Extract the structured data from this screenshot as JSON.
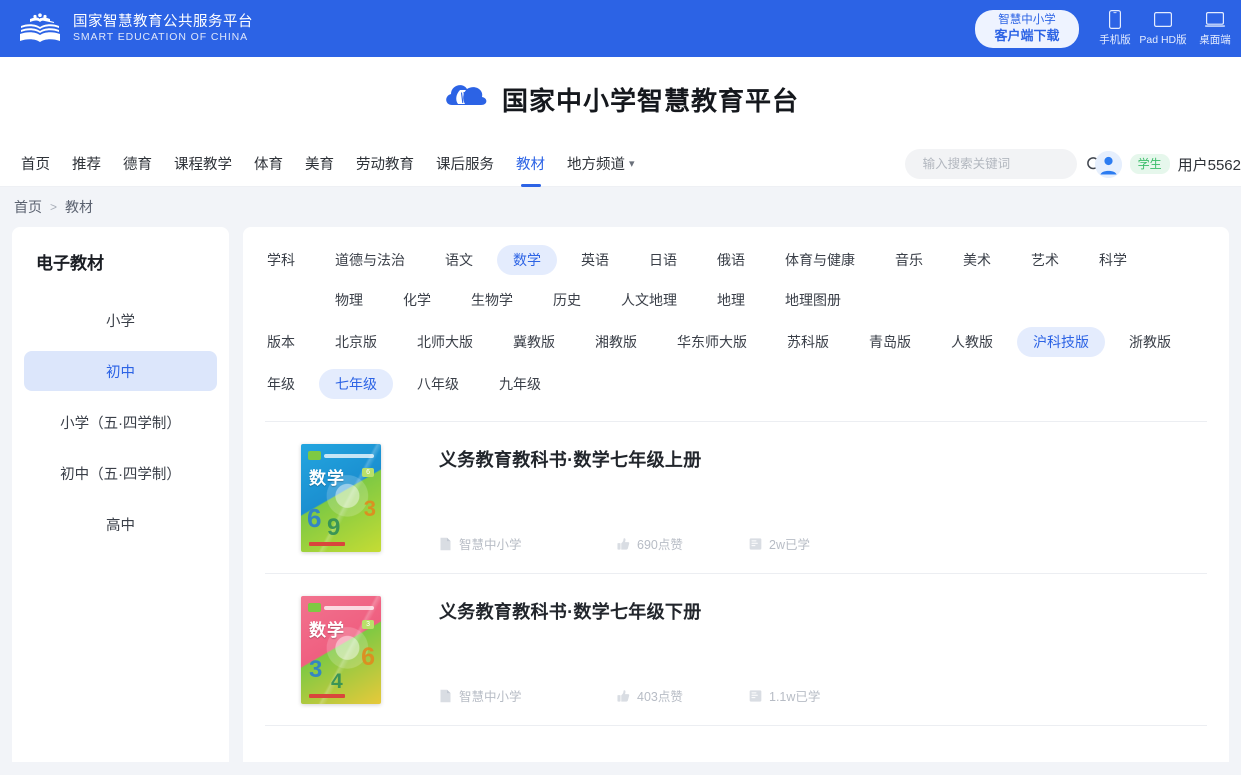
{
  "topbar": {
    "brand_cn": "国家智慧教育公共服务平台",
    "brand_en": "SMART EDUCATION OF CHINA",
    "logo_icon": "open-book-icon",
    "client_download": {
      "line1": "智慧中小学",
      "line2": "客户端下载"
    },
    "downloads": [
      {
        "label": "手机版",
        "icon": "phone-icon"
      },
      {
        "label": "Pad HD版",
        "icon": "tablet-icon"
      },
      {
        "label": "桌面端",
        "icon": "desktop-icon"
      }
    ],
    "bg_color": "#2c63e5"
  },
  "header": {
    "title": "国家中小学智慧教育平台",
    "logo_icon": "cloud-book-icon"
  },
  "nav": {
    "items": [
      {
        "label": "首页",
        "active": false
      },
      {
        "label": "推荐",
        "active": false
      },
      {
        "label": "德育",
        "active": false
      },
      {
        "label": "课程教学",
        "active": false
      },
      {
        "label": "体育",
        "active": false
      },
      {
        "label": "美育",
        "active": false
      },
      {
        "label": "劳动教育",
        "active": false
      },
      {
        "label": "课后服务",
        "active": false
      },
      {
        "label": "教材",
        "active": true
      },
      {
        "label": "地方频道",
        "active": false,
        "caret": true
      }
    ],
    "accent_color": "#2c63e5"
  },
  "search": {
    "placeholder": "输入搜索关键词",
    "value": "",
    "icon": "search-icon"
  },
  "user": {
    "avatar_icon": "user-avatar-icon",
    "role": "学生",
    "name": "用户5562",
    "role_color": "#3bbd6a"
  },
  "breadcrumb": {
    "items": [
      "首页",
      "教材"
    ],
    "separator": ">"
  },
  "sidebar": {
    "title": "电子教材",
    "items": [
      {
        "label": "小学",
        "active": false
      },
      {
        "label": "初中",
        "active": true
      },
      {
        "label": "小学（五·四学制）",
        "active": false
      },
      {
        "label": "初中（五·四学制）",
        "active": false
      },
      {
        "label": "高中",
        "active": false
      }
    ]
  },
  "filters": [
    {
      "label": "学科",
      "options": [
        {
          "label": "道德与法治",
          "active": false
        },
        {
          "label": "语文",
          "active": false
        },
        {
          "label": "数学",
          "active": true
        },
        {
          "label": "英语",
          "active": false
        },
        {
          "label": "日语",
          "active": false
        },
        {
          "label": "俄语",
          "active": false
        },
        {
          "label": "体育与健康",
          "active": false
        },
        {
          "label": "音乐",
          "active": false
        },
        {
          "label": "美术",
          "active": false
        },
        {
          "label": "艺术",
          "active": false
        },
        {
          "label": "科学",
          "active": false
        },
        {
          "label": "物理",
          "active": false
        },
        {
          "label": "化学",
          "active": false
        },
        {
          "label": "生物学",
          "active": false
        },
        {
          "label": "历史",
          "active": false
        },
        {
          "label": "人文地理",
          "active": false
        },
        {
          "label": "地理",
          "active": false
        },
        {
          "label": "地理图册",
          "active": false
        }
      ]
    },
    {
      "label": "版本",
      "options": [
        {
          "label": "北京版",
          "active": false
        },
        {
          "label": "北师大版",
          "active": false
        },
        {
          "label": "冀教版",
          "active": false
        },
        {
          "label": "湘教版",
          "active": false
        },
        {
          "label": "华东师大版",
          "active": false
        },
        {
          "label": "苏科版",
          "active": false
        },
        {
          "label": "青岛版",
          "active": false
        },
        {
          "label": "人教版",
          "active": false
        },
        {
          "label": "沪科技版",
          "active": true
        },
        {
          "label": "浙教版",
          "active": false
        }
      ]
    },
    {
      "label": "年级",
      "options": [
        {
          "label": "七年级",
          "active": true
        },
        {
          "label": "八年级",
          "active": false
        },
        {
          "label": "九年级",
          "active": false
        }
      ]
    }
  ],
  "books": [
    {
      "title": "义务教育教科书·数学七年级上册",
      "cover_subject": "数学",
      "cover_theme": "blue",
      "cover_numbers": [
        "6",
        "9",
        "3"
      ],
      "publisher": {
        "icon": "document-icon",
        "text": "智慧中小学"
      },
      "likes": {
        "icon": "thumbs-up-icon",
        "text": "690点赞"
      },
      "learners": {
        "icon": "study-icon",
        "text": "2w已学"
      }
    },
    {
      "title": "义务教育教科书·数学七年级下册",
      "cover_subject": "数学",
      "cover_theme": "pink",
      "cover_numbers": [
        "3",
        "6",
        "4"
      ],
      "publisher": {
        "icon": "document-icon",
        "text": "智慧中小学"
      },
      "likes": {
        "icon": "thumbs-up-icon",
        "text": "403点赞"
      },
      "learners": {
        "icon": "study-icon",
        "text": "1.1w已学"
      }
    }
  ]
}
